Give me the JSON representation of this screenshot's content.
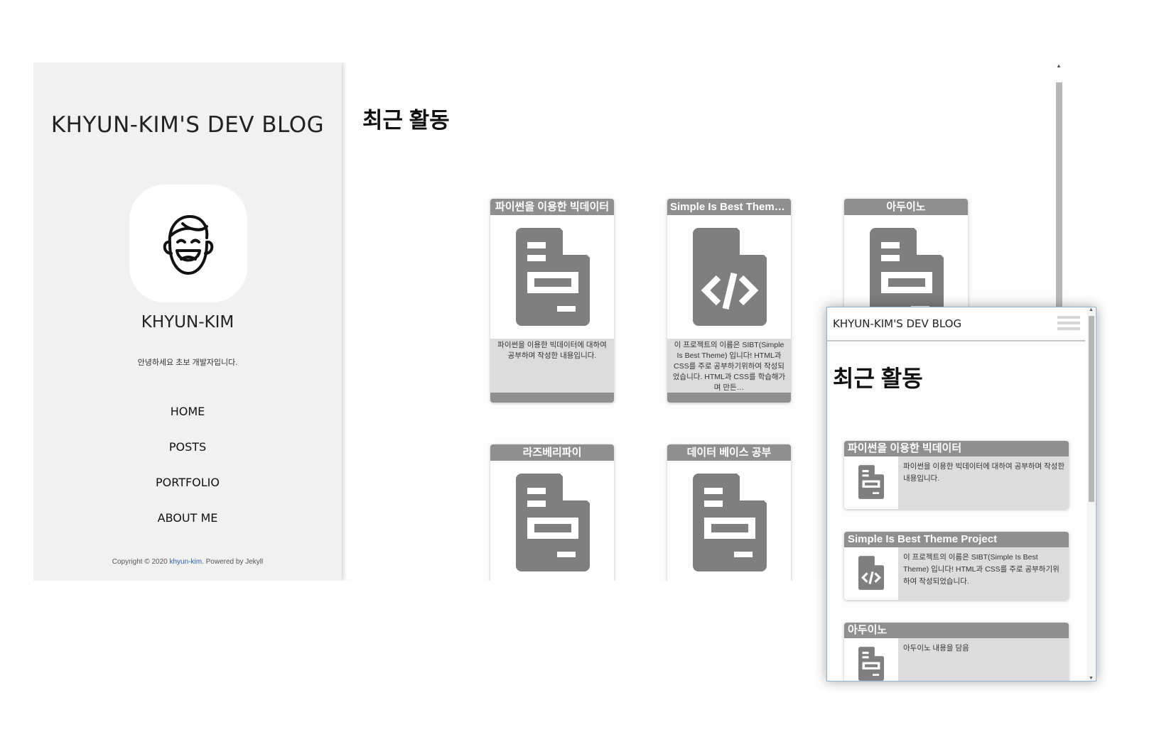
{
  "desktop": {
    "sidebar": {
      "blog_title": "KHYUN-KIM'S DEV BLOG",
      "profile_name": "KHYUN-KIM",
      "intro": "안녕하세요 초보 개발자입니다.",
      "nav": [
        "HOME",
        "POSTS",
        "PORTFOLIO",
        "ABOUT ME"
      ],
      "copyright_prefix": "Copyright © 2020 ",
      "copyright_link": "khyun-kim",
      "copyright_suffix": ". Powered by Jekyll"
    },
    "main": {
      "title": "최근 활동",
      "cards": [
        {
          "title": "파이썬을 이용한 빅데이터",
          "icon": "document-icon",
          "desc": "파이썬을 이용한 빅데이터에 대하여 공부하며 작성한 내용입니다."
        },
        {
          "title": "Simple Is Best Theme...",
          "icon": "code-file-icon",
          "desc": "이 프로젝트의 이름은 SIBT(Simple Is Best Theme) 입니다! HTML과 CSS를 주로 공부하기위하여 작성되었습니다. HTML과 CSS를 학습해가며 만든…"
        },
        {
          "title": "아두이노",
          "icon": "document-icon",
          "desc": ""
        },
        {
          "title": "라즈베리파이",
          "icon": "document-icon",
          "desc": ""
        },
        {
          "title": "데이터 베이스 공부",
          "icon": "document-icon",
          "desc": ""
        }
      ]
    }
  },
  "mobile": {
    "blog_title": "KHYUN-KIM'S DEV BLOG",
    "title": "최근 활동",
    "cards": [
      {
        "title": "파이썬을 이용한 빅데이터",
        "icon": "document-icon",
        "desc": "파이썬을 이용한 빅데이터에 대하여 공부하며 작성한 내용입니다."
      },
      {
        "title": "Simple Is Best Theme Project",
        "icon": "code-file-icon",
        "desc": "이 프로젝트의 이름은 SIBT(Simple Is Best Theme) 입니다! HTML과 CSS를 주로 공부하기위하여 작성되었습니다."
      },
      {
        "title": "아두이노",
        "icon": "document-icon",
        "desc": "아두이노 내용을 담음"
      }
    ]
  },
  "colors": {
    "sidebar_bg": "#f1f1f1",
    "card_header": "#8f8f8f",
    "card_body": "#dcdcdc",
    "icon_gray": "#7f7f7f",
    "link": "#2a5db0"
  }
}
